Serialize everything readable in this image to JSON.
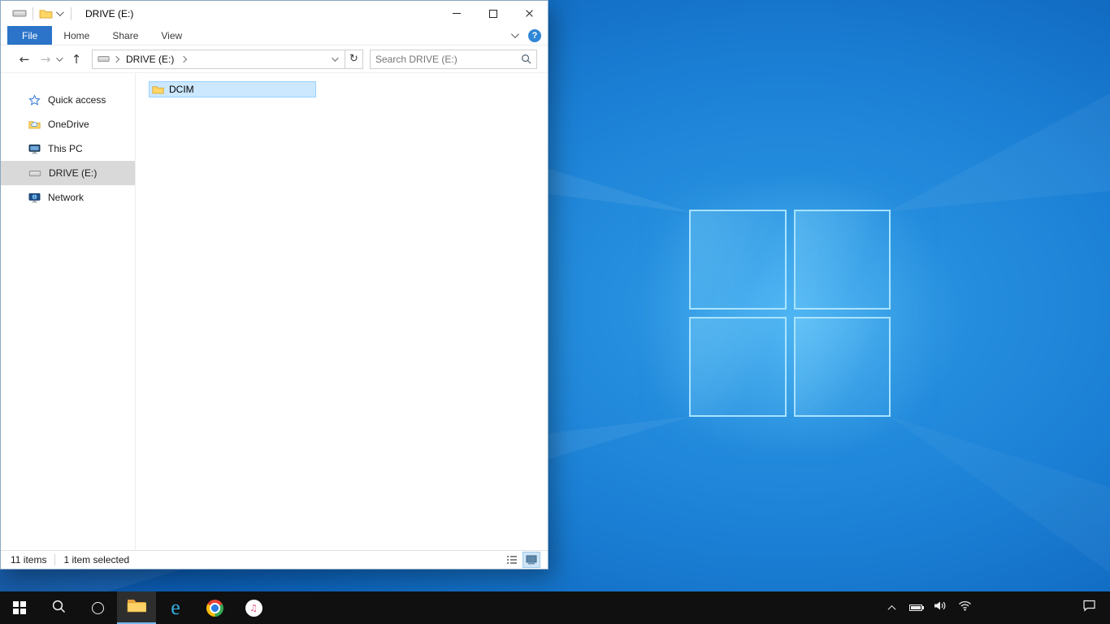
{
  "colors": {
    "file_tab": "#2b74c9",
    "accent": "#0078d7",
    "selection_bg": "#cce8ff",
    "selection_border": "#99d1ff",
    "sidebar_selected": "#d9d9d9",
    "taskbar_bg": "#101010",
    "folder": "#ffd567"
  },
  "explorer": {
    "title": "DRIVE (E:)",
    "tabs": [
      {
        "label": "File"
      },
      {
        "label": "Home"
      },
      {
        "label": "Share"
      },
      {
        "label": "View"
      }
    ],
    "help_label": "?",
    "address": {
      "location": "DRIVE (E:)"
    },
    "search": {
      "placeholder": "Search DRIVE (E:)"
    },
    "sidebar": [
      {
        "label": "Quick access",
        "icon": "star-icon"
      },
      {
        "label": "OneDrive",
        "icon": "onedrive-icon"
      },
      {
        "label": "This PC",
        "icon": "this-pc-icon"
      },
      {
        "label": "DRIVE (E:)",
        "icon": "drive-icon",
        "selected": true
      },
      {
        "label": "Network",
        "icon": "network-icon"
      }
    ],
    "files": [
      {
        "name": "DCIM",
        "icon": "folder-icon",
        "selected": true
      }
    ],
    "status": {
      "items": "11 items",
      "selection": "1 item selected"
    }
  },
  "taskbar": {
    "ie_glyph": "e",
    "itunes_glyph": "♫"
  }
}
